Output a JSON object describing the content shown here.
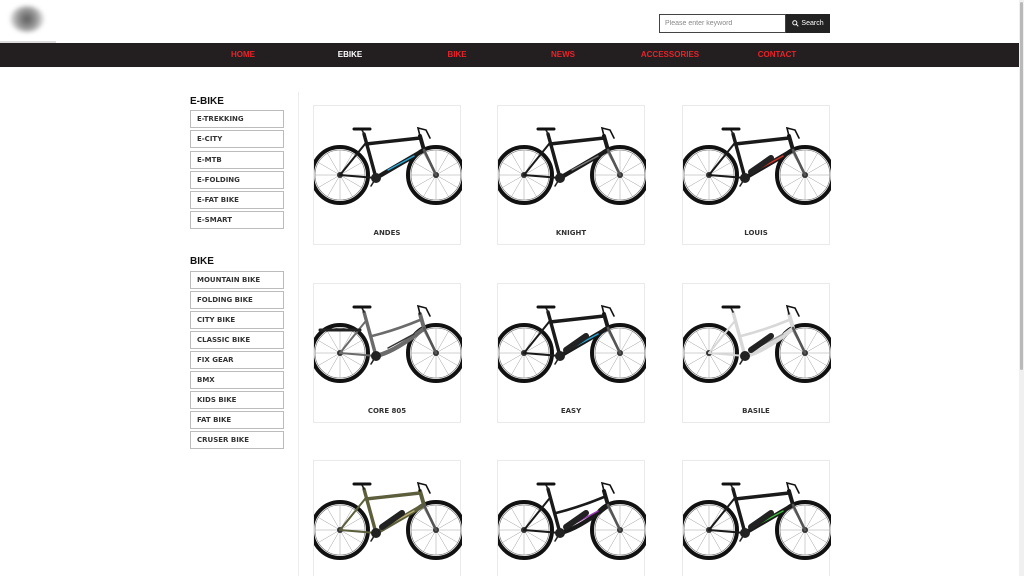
{
  "header": {
    "search_placeholder": "Please enter keyword",
    "search_button": "Search"
  },
  "nav": {
    "items": [
      "HOME",
      "EBIKE",
      "BIKE",
      "NEWS",
      "ACCESSORIES",
      "CONTACT"
    ],
    "active": "EBIKE"
  },
  "sidebar": {
    "ebike_title": "E-BIKE",
    "ebike_items": [
      "E-TREKKING",
      "E-CITY",
      "E-MTB",
      "E-FOLDING",
      "E-FAT BIKE",
      "E-SMART"
    ],
    "bike_title": "BIKE",
    "bike_items": [
      "MOUNTAIN BIKE",
      "FOLDING BIKE",
      "CITY BIKE",
      "CLASSIC BIKE",
      "FIX GEAR",
      "BMX",
      "KIDS BIKE",
      "FAT BIKE",
      "CRUSER BIKE"
    ]
  },
  "products": [
    {
      "name": "ANDES",
      "frame": "#1a1a1a",
      "accent": "#2aa8d8",
      "style": "mtb"
    },
    {
      "name": "KNIGHT",
      "frame": "#1a1a1a",
      "accent": "#7a7a7a",
      "style": "mtb"
    },
    {
      "name": "LOUIS",
      "frame": "#1a1a1a",
      "accent": "#d8342a",
      "style": "ebike"
    },
    {
      "name": "CORE 805",
      "frame": "#6b6b6b",
      "accent": "#333333",
      "style": "city"
    },
    {
      "name": "EASY",
      "frame": "#1a1a1a",
      "accent": "#2aa8d8",
      "style": "ebike"
    },
    {
      "name": "BASILE",
      "frame": "#d8d8d8",
      "accent": "#999999",
      "style": "step"
    },
    {
      "name": "",
      "frame": "#5c5e3c",
      "accent": "#b8b070",
      "style": "ebike"
    },
    {
      "name": "",
      "frame": "#1a1a1a",
      "accent": "#a03ab8",
      "style": "step"
    },
    {
      "name": "",
      "frame": "#1a1a1a",
      "accent": "#3cb83c",
      "style": "ebike"
    }
  ]
}
